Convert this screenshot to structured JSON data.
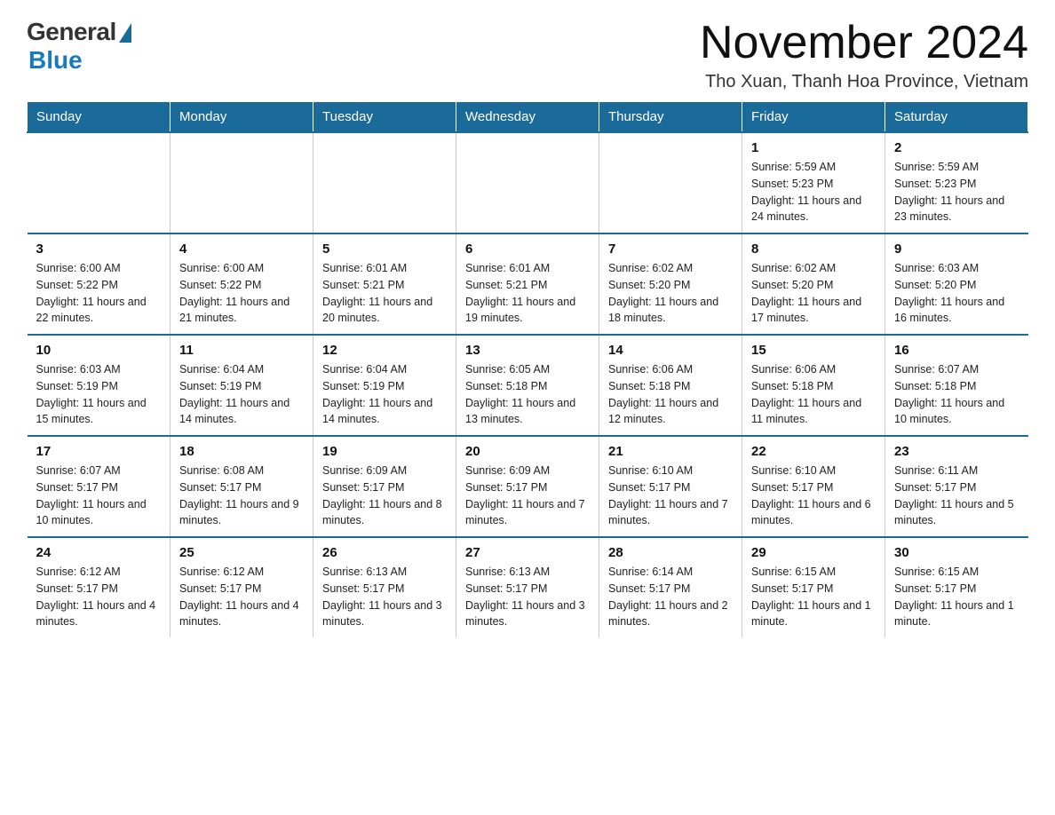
{
  "logo": {
    "general": "General",
    "blue": "Blue"
  },
  "title": "November 2024",
  "location": "Tho Xuan, Thanh Hoa Province, Vietnam",
  "days_of_week": [
    "Sunday",
    "Monday",
    "Tuesday",
    "Wednesday",
    "Thursday",
    "Friday",
    "Saturday"
  ],
  "weeks": [
    [
      {
        "day": "",
        "info": ""
      },
      {
        "day": "",
        "info": ""
      },
      {
        "day": "",
        "info": ""
      },
      {
        "day": "",
        "info": ""
      },
      {
        "day": "",
        "info": ""
      },
      {
        "day": "1",
        "info": "Sunrise: 5:59 AM\nSunset: 5:23 PM\nDaylight: 11 hours and 24 minutes."
      },
      {
        "day": "2",
        "info": "Sunrise: 5:59 AM\nSunset: 5:23 PM\nDaylight: 11 hours and 23 minutes."
      }
    ],
    [
      {
        "day": "3",
        "info": "Sunrise: 6:00 AM\nSunset: 5:22 PM\nDaylight: 11 hours and 22 minutes."
      },
      {
        "day": "4",
        "info": "Sunrise: 6:00 AM\nSunset: 5:22 PM\nDaylight: 11 hours and 21 minutes."
      },
      {
        "day": "5",
        "info": "Sunrise: 6:01 AM\nSunset: 5:21 PM\nDaylight: 11 hours and 20 minutes."
      },
      {
        "day": "6",
        "info": "Sunrise: 6:01 AM\nSunset: 5:21 PM\nDaylight: 11 hours and 19 minutes."
      },
      {
        "day": "7",
        "info": "Sunrise: 6:02 AM\nSunset: 5:20 PM\nDaylight: 11 hours and 18 minutes."
      },
      {
        "day": "8",
        "info": "Sunrise: 6:02 AM\nSunset: 5:20 PM\nDaylight: 11 hours and 17 minutes."
      },
      {
        "day": "9",
        "info": "Sunrise: 6:03 AM\nSunset: 5:20 PM\nDaylight: 11 hours and 16 minutes."
      }
    ],
    [
      {
        "day": "10",
        "info": "Sunrise: 6:03 AM\nSunset: 5:19 PM\nDaylight: 11 hours and 15 minutes."
      },
      {
        "day": "11",
        "info": "Sunrise: 6:04 AM\nSunset: 5:19 PM\nDaylight: 11 hours and 14 minutes."
      },
      {
        "day": "12",
        "info": "Sunrise: 6:04 AM\nSunset: 5:19 PM\nDaylight: 11 hours and 14 minutes."
      },
      {
        "day": "13",
        "info": "Sunrise: 6:05 AM\nSunset: 5:18 PM\nDaylight: 11 hours and 13 minutes."
      },
      {
        "day": "14",
        "info": "Sunrise: 6:06 AM\nSunset: 5:18 PM\nDaylight: 11 hours and 12 minutes."
      },
      {
        "day": "15",
        "info": "Sunrise: 6:06 AM\nSunset: 5:18 PM\nDaylight: 11 hours and 11 minutes."
      },
      {
        "day": "16",
        "info": "Sunrise: 6:07 AM\nSunset: 5:18 PM\nDaylight: 11 hours and 10 minutes."
      }
    ],
    [
      {
        "day": "17",
        "info": "Sunrise: 6:07 AM\nSunset: 5:17 PM\nDaylight: 11 hours and 10 minutes."
      },
      {
        "day": "18",
        "info": "Sunrise: 6:08 AM\nSunset: 5:17 PM\nDaylight: 11 hours and 9 minutes."
      },
      {
        "day": "19",
        "info": "Sunrise: 6:09 AM\nSunset: 5:17 PM\nDaylight: 11 hours and 8 minutes."
      },
      {
        "day": "20",
        "info": "Sunrise: 6:09 AM\nSunset: 5:17 PM\nDaylight: 11 hours and 7 minutes."
      },
      {
        "day": "21",
        "info": "Sunrise: 6:10 AM\nSunset: 5:17 PM\nDaylight: 11 hours and 7 minutes."
      },
      {
        "day": "22",
        "info": "Sunrise: 6:10 AM\nSunset: 5:17 PM\nDaylight: 11 hours and 6 minutes."
      },
      {
        "day": "23",
        "info": "Sunrise: 6:11 AM\nSunset: 5:17 PM\nDaylight: 11 hours and 5 minutes."
      }
    ],
    [
      {
        "day": "24",
        "info": "Sunrise: 6:12 AM\nSunset: 5:17 PM\nDaylight: 11 hours and 4 minutes."
      },
      {
        "day": "25",
        "info": "Sunrise: 6:12 AM\nSunset: 5:17 PM\nDaylight: 11 hours and 4 minutes."
      },
      {
        "day": "26",
        "info": "Sunrise: 6:13 AM\nSunset: 5:17 PM\nDaylight: 11 hours and 3 minutes."
      },
      {
        "day": "27",
        "info": "Sunrise: 6:13 AM\nSunset: 5:17 PM\nDaylight: 11 hours and 3 minutes."
      },
      {
        "day": "28",
        "info": "Sunrise: 6:14 AM\nSunset: 5:17 PM\nDaylight: 11 hours and 2 minutes."
      },
      {
        "day": "29",
        "info": "Sunrise: 6:15 AM\nSunset: 5:17 PM\nDaylight: 11 hours and 1 minute."
      },
      {
        "day": "30",
        "info": "Sunrise: 6:15 AM\nSunset: 5:17 PM\nDaylight: 11 hours and 1 minute."
      }
    ]
  ]
}
